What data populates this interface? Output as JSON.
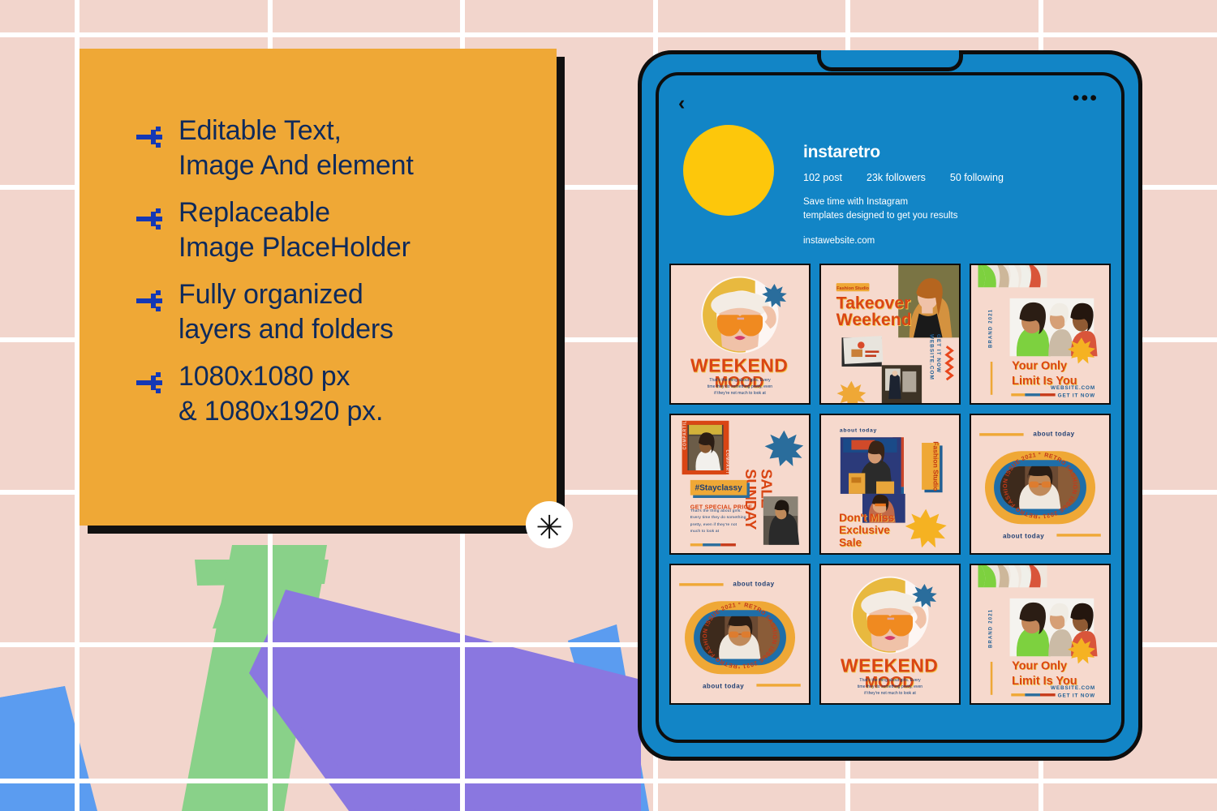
{
  "background": {
    "base_color": "#f2d5cc",
    "grid_line_color": "#ffffff",
    "shapes": [
      {
        "name": "green-band",
        "color": "#89d189"
      },
      {
        "name": "purple-band",
        "color": "#8a77e0"
      },
      {
        "name": "blue-shape-left",
        "color": "#5b9cf0"
      },
      {
        "name": "blue-shape-right",
        "color": "#5b9cf0"
      }
    ]
  },
  "feature_card": {
    "bg_color": "#efa836",
    "shadow_color": "#111111",
    "text_color": "#0e2a5c",
    "arrow_color": "#1438b5",
    "arrow_icon_name": "pixel-arrow-right-icon",
    "items": [
      "Editable Text,\nImage And element",
      "Replaceable\nImage PlaceHolder",
      "Fully organized\nlayers and folders",
      "1080x1080 px\n& 1080x1920 px."
    ]
  },
  "asterisk_badge": {
    "glyph": "✳",
    "bg_color": "#ffffff",
    "glyph_color": "#111111"
  },
  "tablet": {
    "frame_color": "#1285c6",
    "outline_color": "#0d0d0d",
    "topbar": {
      "back_icon": "‹",
      "more_icon": "•••"
    },
    "profile": {
      "avatar_color": "#fdc70b",
      "username": "instaretro",
      "stats": [
        "102 post",
        "23k followers",
        "50 following"
      ],
      "bio": "Save time with Instagram\ntemplates designed to get you results",
      "website": "instawebsite.com"
    },
    "posts": [
      {
        "id": "post-weekend-mood-1",
        "layout": "weekend-mood",
        "bg": "#f6d9cd",
        "headline_line1": "WEEKEND",
        "headline_line2": "MOOD",
        "body": "That's the thing about girls. Every\ntime they do something pretty, even\nif they're not much to look at",
        "accent_star_color": "#2a6d9c",
        "headline_color": "#d94514"
      },
      {
        "id": "post-takeover-weekend",
        "layout": "takeover",
        "bg": "#f6d9cd",
        "tag": "Fashion Studio",
        "headline_line1": "Takeover",
        "headline_line2": "Weekend",
        "vertical_text": "WEBSITE.COM\nGET IT NOW",
        "headline_color": "#d94514",
        "tag_bg": "#efa836"
      },
      {
        "id": "post-your-only-limit-1",
        "layout": "only-limit",
        "bg": "#f6d9cd",
        "headline_line1": "Your Only",
        "headline_line2": "Limit Is You",
        "vertical_text": "BRAND 2021",
        "footer_line1": "WEBSITE.COM",
        "footer_line2": "GET IT NOW",
        "headline_color": "#d94514",
        "sun_color": "#f5b222"
      },
      {
        "id": "post-sunday-sale",
        "layout": "sunday-sale",
        "bg": "#f6d9cd",
        "vertical_headline_1": "SUNDAY",
        "vertical_headline_2": "SALE",
        "frame_text": "COMPARTILHA",
        "hashtag": "#Stayclassy",
        "subhead": "GET SPECIAL PRICE",
        "body": "That's the thing about girls.\nEvery time they do something\npretty, even if they're not\nmuch to look at",
        "star_color": "#2a6d9c",
        "hashtag_bg": "#efa836",
        "hashtag_shadow": "#2a6d9c"
      },
      {
        "id": "post-dont-miss-sale",
        "layout": "dont-miss",
        "bg": "#f6d9cd",
        "eyebrow": "about today",
        "side_tag": "Fashion Studio",
        "headline_line1": "Don't Miss",
        "headline_line2": "Exclusive",
        "headline_line3": "Sale",
        "sun_color": "#f5b222",
        "side_tag_bg": "#efa836",
        "side_tag_shadow": "#1f5f95"
      },
      {
        "id": "post-retro-oval-1",
        "layout": "retro-oval",
        "bg": "#f6d9cd",
        "eyebrow_top": "about today",
        "eyebrow_bottom": "about today",
        "ring_text": "RETRO FASHION ISSUE 2021 °RETRO FASHION ISSUE 2021 °",
        "ring_outer_color": "#efa836",
        "ring_inner_color": "#1f6ea8"
      },
      {
        "id": "post-retro-oval-2",
        "layout": "retro-oval",
        "bg": "#f6d9cd",
        "eyebrow_top": "about today",
        "eyebrow_bottom": "about today",
        "ring_text": "RETRO FASHION ISSUE 2021 °RETRO FASHION ISSUE 2021 °",
        "ring_outer_color": "#efa836",
        "ring_inner_color": "#1f6ea8"
      },
      {
        "id": "post-weekend-mood-2",
        "layout": "weekend-mood",
        "bg": "#f6d9cd",
        "headline_line1": "WEEKEND",
        "headline_line2": "MOOD",
        "body": "That's the thing about girls. Every\ntime they do something pretty, even\nif they're not much to look at",
        "accent_star_color": "#2a6d9c",
        "headline_color": "#d94514"
      },
      {
        "id": "post-your-only-limit-2",
        "layout": "only-limit",
        "bg": "#f6d9cd",
        "headline_line1": "Your Only",
        "headline_line2": "Limit Is You",
        "vertical_text": "BRAND 2021",
        "footer_line1": "WEBSITE.COM",
        "footer_line2": "GET IT NOW",
        "headline_color": "#d94514",
        "sun_color": "#f5b222"
      }
    ]
  }
}
